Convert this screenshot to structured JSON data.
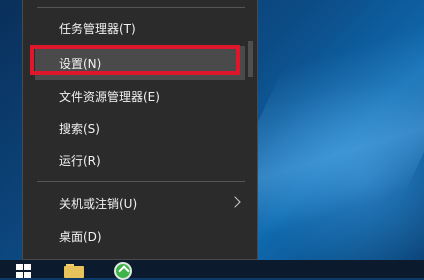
{
  "context_menu": {
    "items": [
      {
        "label": "任务管理器(T)"
      },
      {
        "label": "设置(N)"
      },
      {
        "label": "文件资源管理器(E)"
      },
      {
        "label": "搜索(S)"
      },
      {
        "label": "运行(R)"
      },
      {
        "label": "关机或注销(U)"
      },
      {
        "label": "桌面(D)"
      }
    ],
    "selected_index": 1,
    "highlight_color": "#e0162b"
  },
  "taskbar": {
    "icons": [
      "windows-start-icon",
      "file-explorer-icon",
      "refresh-app-icon"
    ]
  }
}
